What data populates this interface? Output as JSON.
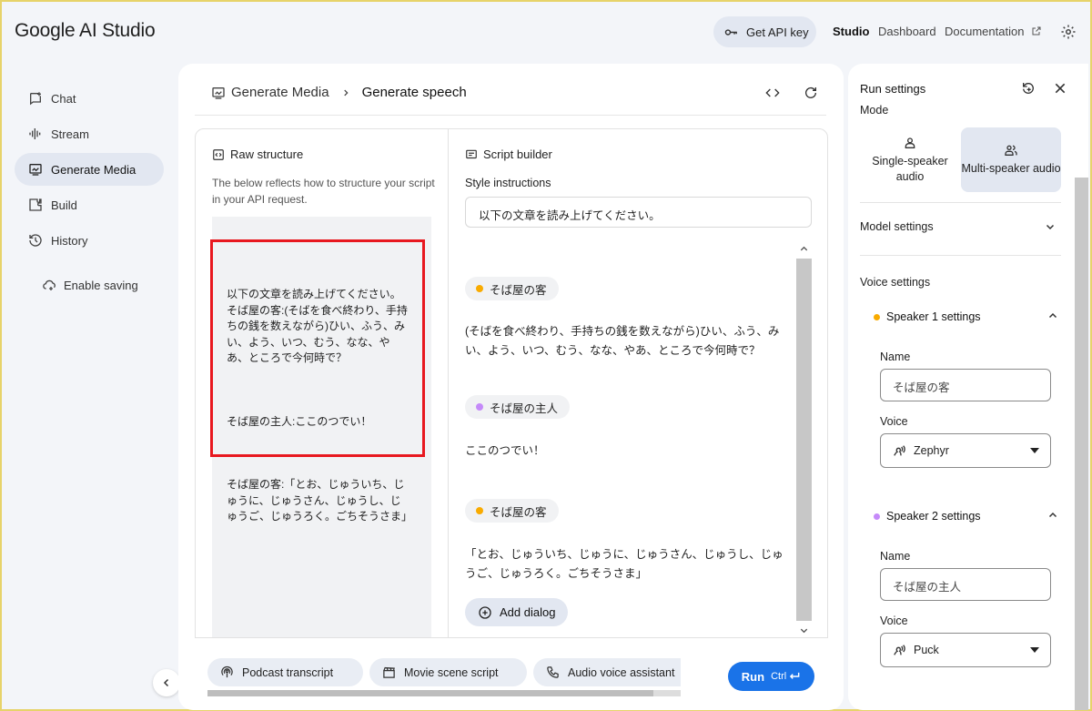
{
  "app": {
    "logo_google": "Google",
    "logo_product": "AI Studio",
    "get_api_key": "Get API key",
    "nav": {
      "studio": "Studio",
      "dashboard": "Dashboard",
      "documentation": "Documentation"
    }
  },
  "sidebar": {
    "items": [
      {
        "label": "Chat",
        "icon": "chat-icon"
      },
      {
        "label": "Stream",
        "icon": "stream-icon"
      },
      {
        "label": "Generate Media",
        "icon": "media-icon",
        "active": true
      },
      {
        "label": "Build",
        "icon": "build-icon"
      },
      {
        "label": "History",
        "icon": "history-icon"
      }
    ],
    "enable_saving": "Enable saving"
  },
  "main": {
    "breadcrumb": {
      "parent": "Generate Media",
      "current": "Generate speech"
    },
    "raw": {
      "title": "Raw structure",
      "description": "The below reflects how to structure your script in your API request.",
      "lines": [
        "以下の文章を読み上げてください。\nそば屋の客:(そばを食べ終わり、手持ちの銭を数えながら)ひい、ふう、みい、よう、いつ、むう、なな、やあ、ところで今何時で？",
        "そば屋の主人:ここのつでい！",
        "そば屋の客:「とお、じゅういち、じゅうに、じゅうさん、じゅうし、じゅうご、じゅうろく。ごちそうさま」"
      ]
    },
    "script": {
      "title": "Script builder",
      "style_label": "Style instructions",
      "style_value": "以下の文章を読み上げてください。",
      "dialogs": [
        {
          "speaker": "そば屋の客",
          "color": "#f9ab00",
          "text": "(そばを食べ終わり、手持ちの銭を数えながら)ひい、ふう、みい、よう、いつ、むう、なな、やあ、ところで今何時で？"
        },
        {
          "speaker": "そば屋の主人",
          "color": "#c58af9",
          "text": "ここのつでい！"
        },
        {
          "speaker": "そば屋の客",
          "color": "#f9ab00",
          "text": "「とお、じゅういち、じゅうに、じゅうさん、じゅうし、じゅうご、じゅうろく。ごちそうさま」"
        }
      ],
      "add_dialog": "Add dialog"
    },
    "templates": [
      "Podcast transcript",
      "Movie scene script",
      "Audio voice assistant"
    ],
    "run": {
      "label": "Run",
      "shortcut": "Ctrl"
    }
  },
  "run_settings": {
    "title": "Run settings",
    "mode_label": "Mode",
    "modes": [
      {
        "label": "Single-speaker audio",
        "active": false
      },
      {
        "label": "Multi-speaker audio",
        "active": true
      }
    ],
    "model_settings": "Model settings",
    "voice_settings": "Voice settings",
    "speakers": [
      {
        "title": "Speaker 1 settings",
        "color": "#f9ab00",
        "name_label": "Name",
        "name": "そば屋の客",
        "voice_label": "Voice",
        "voice": "Zephyr"
      },
      {
        "title": "Speaker 2 settings",
        "color": "#c58af9",
        "name_label": "Name",
        "name": "そば屋の主人",
        "voice_label": "Voice",
        "voice": "Puck"
      }
    ]
  }
}
